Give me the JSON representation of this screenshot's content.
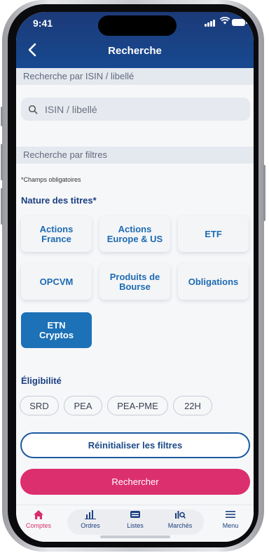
{
  "status_bar": {
    "time": "9:41"
  },
  "header": {
    "title": "Recherche"
  },
  "isin_section": {
    "title": "Recherche par ISIN / libellé",
    "search_placeholder": "ISIN / libellé"
  },
  "filters_section": {
    "title": "Recherche par filtres",
    "required_note": "*Champs obligatoires",
    "nature_label": "Nature des titres*",
    "tiles": [
      {
        "line1": "Actions",
        "line2": "France"
      },
      {
        "line1": "Actions",
        "line2": "Europe & US"
      },
      {
        "line1": "ETF",
        "line2": ""
      },
      {
        "line1": "OPCVM",
        "line2": ""
      },
      {
        "line1": "Produits de",
        "line2": "Bourse"
      },
      {
        "line1": "Obligations",
        "line2": ""
      },
      {
        "line1": "ETN",
        "line2": "Cryptos",
        "selected": true
      }
    ],
    "eligibility_label": "Éligibilité",
    "chips": [
      "SRD",
      "PEA",
      "PEA-PME",
      "22H"
    ]
  },
  "actions": {
    "reset_label": "Réinitialiser les filtres",
    "search_label": "Rechercher"
  },
  "tabbar": {
    "items": [
      {
        "label": "Comptes",
        "icon": "home-icon",
        "active": true
      },
      {
        "label": "Ordres",
        "icon": "bar-chart-icon"
      },
      {
        "label": "Listes",
        "icon": "list-icon"
      },
      {
        "label": "Marchés",
        "icon": "market-search-icon"
      },
      {
        "label": "Menu",
        "icon": "hamburger-icon"
      }
    ]
  },
  "colors": {
    "header": "#1c3a78",
    "accent_pink": "#dc2f6e",
    "selected_tile": "#1c71b7",
    "text_blue": "#1b3f80"
  }
}
